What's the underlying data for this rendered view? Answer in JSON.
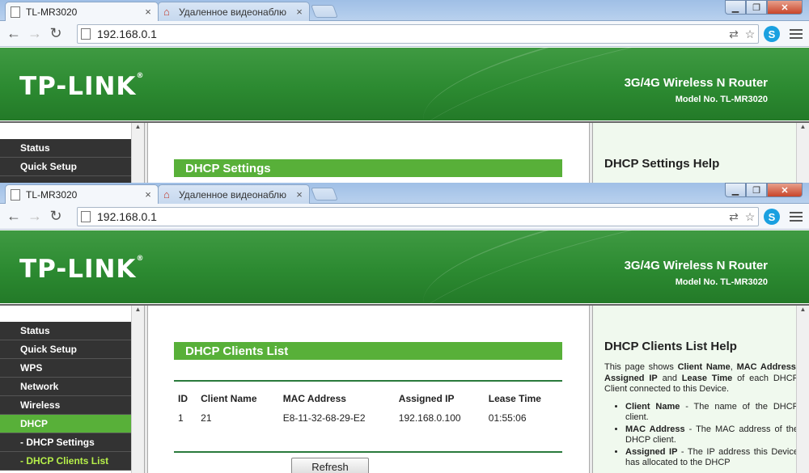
{
  "browser": {
    "tabs": [
      {
        "title": "TL-MR3020",
        "close": "×"
      },
      {
        "title": "Удаленное видеонаблю",
        "close": "×"
      }
    ],
    "url": "192.168.0.1",
    "window_controls": {
      "minimize": "▁",
      "maximize": "❐",
      "close": "✕"
    }
  },
  "banner": {
    "logo": "TP-LINK",
    "logo_mark": "®",
    "product": "3G/4G Wireless N Router",
    "model": "Model No. TL-MR3020"
  },
  "window1": {
    "sidebar": [
      {
        "label": "Status"
      },
      {
        "label": "Quick Setup"
      }
    ],
    "section_title": "DHCP Settings",
    "help_title": "DHCP Settings Help"
  },
  "window2": {
    "sidebar": [
      {
        "label": "Status"
      },
      {
        "label": "Quick Setup"
      },
      {
        "label": "WPS"
      },
      {
        "label": "Network"
      },
      {
        "label": "Wireless"
      },
      {
        "label": "DHCP"
      },
      {
        "label": "- DHCP Settings"
      },
      {
        "label": "- DHCP Clients List"
      }
    ],
    "section_title": "DHCP Clients List",
    "table": {
      "headers": [
        "ID",
        "Client Name",
        "MAC Address",
        "Assigned IP",
        "Lease Time"
      ],
      "rows": [
        [
          "1",
          "21",
          "E8-11-32-68-29-E2",
          "192.168.0.100",
          "01:55:06"
        ]
      ]
    },
    "refresh_label": "Refresh",
    "help_title": "DHCP Clients List Help",
    "help_intro": {
      "p1": "This page shows ",
      "b1": "Client Name",
      "p2": ", ",
      "b2": "MAC Address",
      "p3": ", ",
      "b3": "Assigned IP",
      "p4": " and ",
      "b4": "Lease Time",
      "p5": " of each DHCP Client connected to this Device."
    },
    "help_items": [
      {
        "term": "Client Name",
        "desc": " - The name of the DHCP client."
      },
      {
        "term": "MAC Address",
        "desc": " - The MAC address of the DHCP client."
      },
      {
        "term": "Assigned IP",
        "desc": " - The IP address this Device has allocated to the DHCP"
      }
    ]
  }
}
